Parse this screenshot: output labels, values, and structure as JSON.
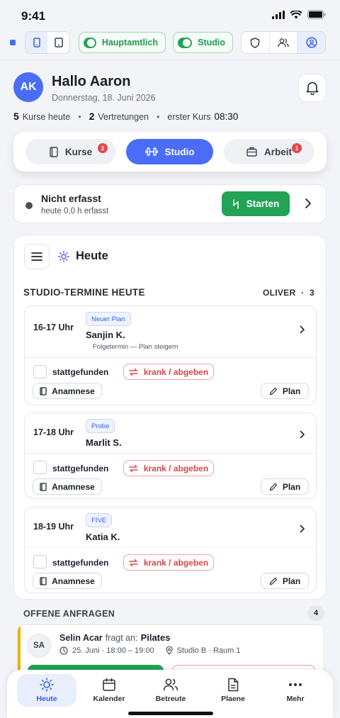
{
  "statusbar": {
    "time": "9:41"
  },
  "toggles": {
    "hauptamtlich": "Hauptamtlich",
    "studio": "Studio"
  },
  "header": {
    "avatar_initials": "AK",
    "greeting": "Hallo Aaron",
    "date": "Donnerstag, 18. Juni 2026"
  },
  "stats": {
    "courses_count": "5",
    "courses_label": "Kurse heute",
    "subs_count": "2",
    "subs_label": "Vertretungen",
    "first_label": "erster Kurs",
    "first_time": "08:30"
  },
  "tabs": [
    {
      "label": "Kurse",
      "badge": "2"
    },
    {
      "label": "Studio"
    },
    {
      "label": "Arbeit",
      "badge": "1"
    }
  ],
  "tracking": {
    "status": "Nicht erfasst",
    "detail": "heute 0,0 h erfasst",
    "start_label": "Starten"
  },
  "today": {
    "title": "Heute",
    "section_title": "STUDIO-TERMINE HEUTE",
    "section_trainer": "OLIVER",
    "section_count": "3",
    "check_label": "stattgefunden",
    "sick_label": "krank / abgeben",
    "anamnese_label": "Anamnese",
    "plan_label": "Plan",
    "appointments": [
      {
        "time": "16-17 Uhr",
        "tag": "Neuer Plan",
        "name": "Sanjin K.",
        "note": "Folgetermin — Plan steigern"
      },
      {
        "time": "17-18 Uhr",
        "tag": "Probe",
        "name": "Marlit S."
      },
      {
        "time": "18-19 Uhr",
        "tag": "FIVE",
        "name": "Katia K."
      }
    ]
  },
  "requests": {
    "title": "OFFENE ANFRAGEN",
    "count": "4",
    "items": [
      {
        "initials": "SA",
        "name": "Selin Acar",
        "middle": "fragt an:",
        "course": "Pilates",
        "datetime": "25. Juni · 18:00 – 19:00",
        "location": "Studio B · Raum 1"
      }
    ]
  },
  "nav": [
    {
      "label": "Heute",
      "icon": "sun-icon"
    },
    {
      "label": "Kalender",
      "icon": "calendar-icon"
    },
    {
      "label": "Betreute",
      "icon": "users-icon"
    },
    {
      "label": "Plaene",
      "icon": "document-icon"
    },
    {
      "label": "Mehr",
      "icon": "more-icon"
    }
  ],
  "colors": {
    "accent": "#4a6cf7",
    "green": "#22a356",
    "red": "#e5484d",
    "request_bar": "#e8b40a"
  }
}
